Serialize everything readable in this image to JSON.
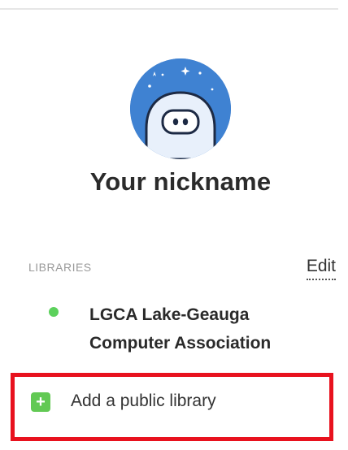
{
  "profile": {
    "nickname": "Your nickname",
    "avatar_icon": "robot-avatar-icon"
  },
  "libraries": {
    "header_label": "LIBRARIES",
    "edit_label": "Edit",
    "items": [
      {
        "name": "LGCA Lake-Geauga Computer Association",
        "status_color": "#5cd15c"
      }
    ],
    "add_label": "Add a public library",
    "add_icon": "plus-icon",
    "add_icon_color": "#62c954",
    "highlight_color": "#e8121e"
  }
}
